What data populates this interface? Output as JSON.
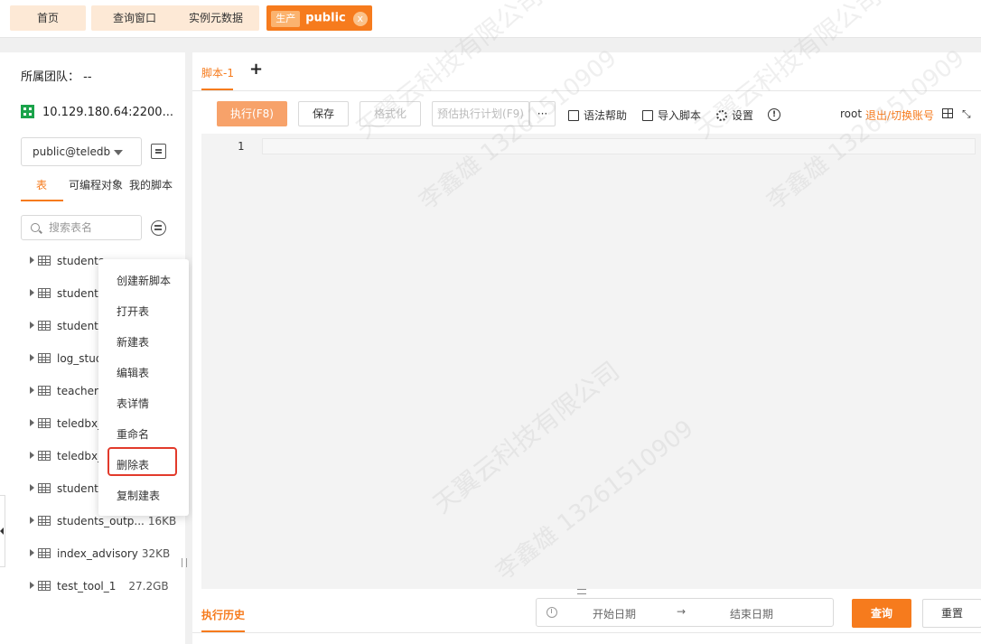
{
  "top_tabs": [
    {
      "label": "首页"
    },
    {
      "label": "查询窗口"
    },
    {
      "label": "实例元数据"
    }
  ],
  "active_tab": {
    "env": "生产",
    "name": "public",
    "close": "x"
  },
  "sidebar": {
    "team": "所属团队： --",
    "server": "10.129.180.64:2200...",
    "db_select": "public@teledb",
    "subtabs": [
      "表",
      "可编程对象",
      "我的脚本"
    ],
    "search_placeholder": "搜索表名",
    "tables": [
      {
        "name": "students",
        "size": ""
      },
      {
        "name": "students",
        "size": ""
      },
      {
        "name": "students",
        "size": ""
      },
      {
        "name": "log_stud",
        "size": ""
      },
      {
        "name": "teachers",
        "size": ""
      },
      {
        "name": "teledbx_",
        "size": ""
      },
      {
        "name": "teledbx_",
        "size": ""
      },
      {
        "name": "students",
        "size": ""
      },
      {
        "name": "students_outp...",
        "size": "16KB"
      },
      {
        "name": "index_advisory",
        "size": "32KB"
      },
      {
        "name": "test_tool_1",
        "size": "27.2GB"
      }
    ]
  },
  "context_menu": {
    "items": [
      "创建新脚本",
      "打开表",
      "新建表",
      "编辑表",
      "表详情",
      "重命名",
      "删除表",
      "复制建表"
    ],
    "highlighted": "删除表"
  },
  "editor": {
    "tab": "脚本-1",
    "add_tab": "+",
    "buttons": {
      "run": "执行(F8)",
      "save": "保存",
      "format": "格式化",
      "plan": "预估执行计划(F9)",
      "more": "···"
    },
    "links": {
      "syntax": "语法帮助",
      "import": "导入脚本",
      "settings": "设置",
      "info": "!"
    },
    "user": "root",
    "logout": "退出/切换账号",
    "line_number": "1"
  },
  "history": {
    "tab": "执行历史",
    "start_placeholder": "开始日期",
    "arrow": "→",
    "end_placeholder": "结束日期",
    "query": "查询",
    "reset": "重置"
  },
  "watermark": {
    "company": "天翼云科技有限公司",
    "person": "李鑫雄 13261510909"
  },
  "colors": {
    "accent": "#f67b1d",
    "highlight_border": "#e23a2b"
  }
}
